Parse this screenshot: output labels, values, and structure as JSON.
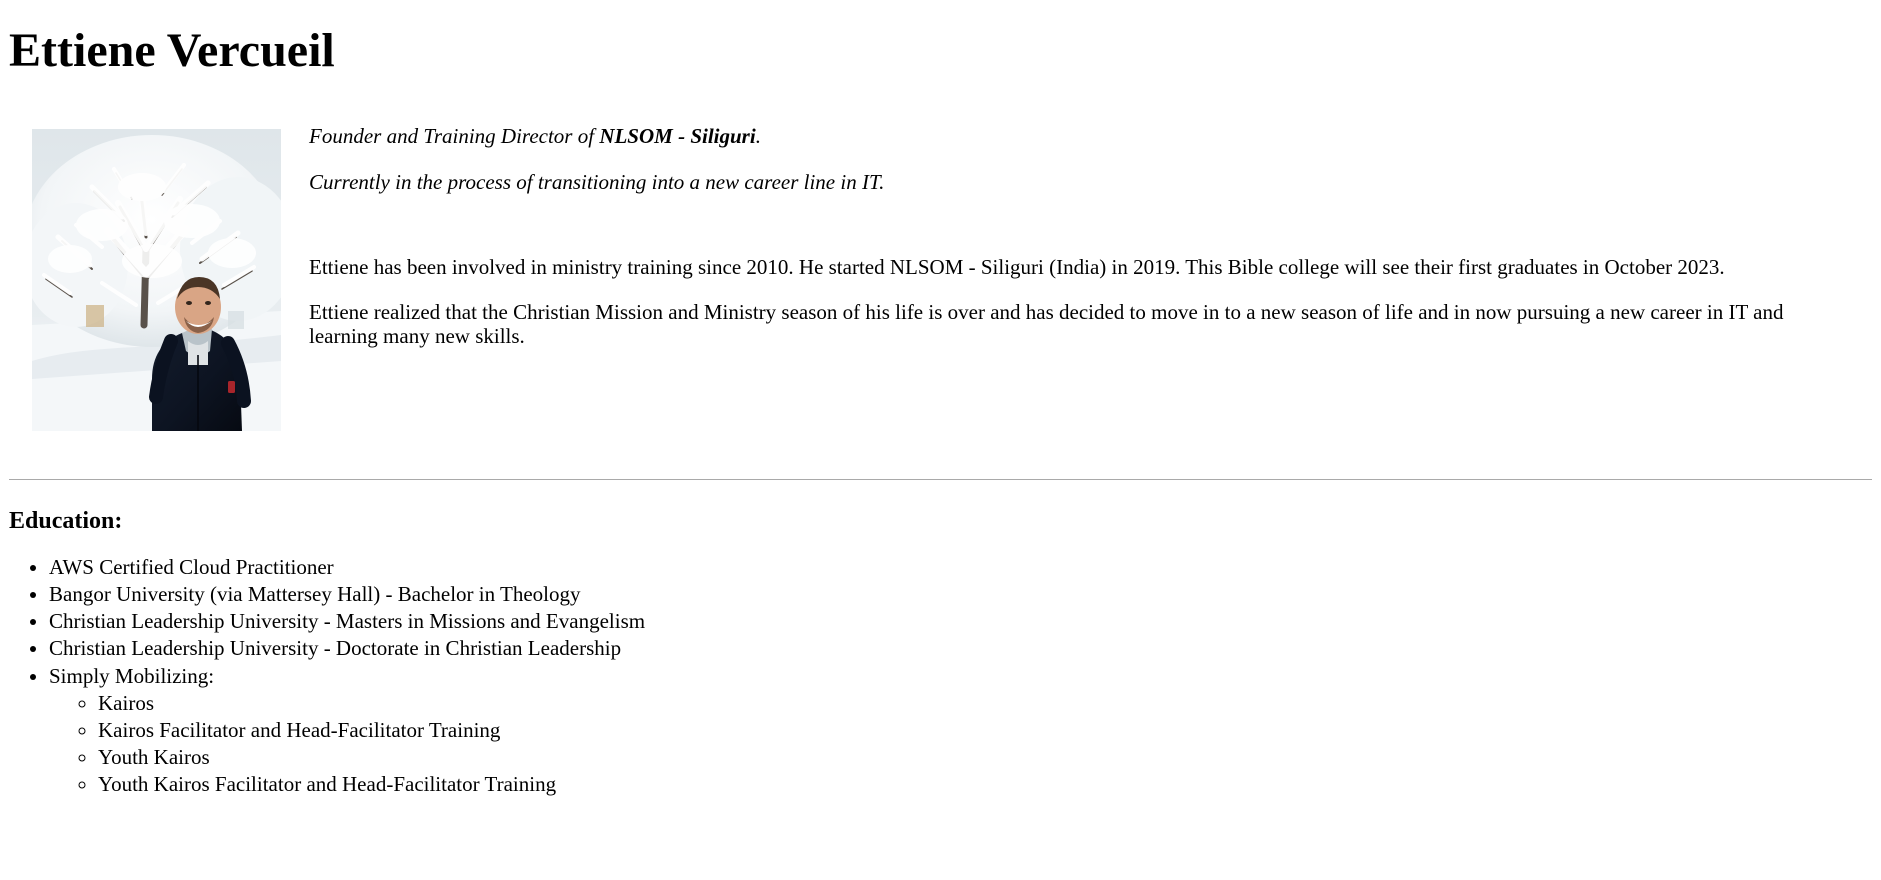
{
  "page_title": "Ettiene Vercueil",
  "profile": {
    "photo_alt": "snowy-winter-portrait",
    "lead_1_prefix": "Founder and Training Director of ",
    "lead_1_org": "NLSOM - Siliguri",
    "lead_1_suffix": ".",
    "lead_2": "Currently in the process of transitioning into a new career line in IT.",
    "paragraph_1": "Ettiene has been involved in ministry training since 2010. He started NLSOM - Siliguri (India) in 2019. This Bible college will see their first graduates in October 2023.",
    "paragraph_2": "Ettiene realized that the Christian Mission and Ministry season of his life is over and has decided to move in to a new season of life and in now pursuing a new career in IT and learning many new skills."
  },
  "education": {
    "heading": "Education:",
    "items": [
      {
        "label": "AWS Certified Cloud Practitioner"
      },
      {
        "label": "Bangor University (via Mattersey Hall) - Bachelor in Theology"
      },
      {
        "label": "Christian Leadership University - Masters in Missions and Evangelism"
      },
      {
        "label": "Christian Leadership University - Doctorate in Christian Leadership"
      },
      {
        "label": "Simply Mobilizing:",
        "children": [
          "Kairos",
          "Kairos Facilitator and Head-Facilitator Training",
          "Youth Kairos",
          "Youth Kairos Facilitator and Head-Facilitator Training"
        ]
      }
    ]
  },
  "colors": {
    "text": "#000000",
    "background": "#ffffff",
    "divider": "#a9a9a9"
  }
}
